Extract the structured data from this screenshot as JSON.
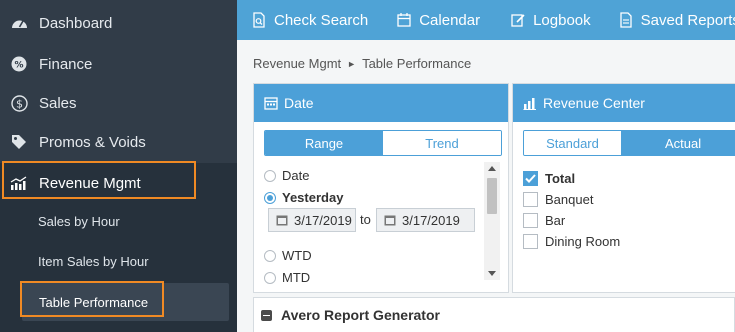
{
  "sidebar": {
    "items": [
      {
        "label": "Dashboard",
        "icon": "speedometer-icon"
      },
      {
        "label": "Finance",
        "icon": "percent-icon"
      },
      {
        "label": "Sales",
        "icon": "dollar-icon"
      },
      {
        "label": "Promos & Voids",
        "icon": "tag-icon"
      },
      {
        "label": "Revenue Mgmt",
        "icon": "bar-trend-icon"
      }
    ],
    "subitems": [
      {
        "label": "Sales by Hour"
      },
      {
        "label": "Item Sales by Hour"
      },
      {
        "label": "Table Performance"
      }
    ]
  },
  "topbar": {
    "items": [
      {
        "label": "Check Search",
        "icon": "document-search-icon"
      },
      {
        "label": "Calendar",
        "icon": "calendar-icon"
      },
      {
        "label": "Logbook",
        "icon": "edit-icon"
      },
      {
        "label": "Saved Reports",
        "icon": "file-icon"
      }
    ]
  },
  "breadcrumb": {
    "parent": "Revenue Mgmt",
    "separator": "►",
    "current": "Table Performance"
  },
  "date_panel": {
    "title": "Date",
    "toggle": {
      "options": [
        "Range",
        "Trend"
      ],
      "selected": "Range"
    },
    "options": [
      {
        "label": "Date",
        "selected": false
      },
      {
        "label": "Yesterday",
        "selected": true
      },
      {
        "label": "WTD",
        "selected": false
      },
      {
        "label": "MTD",
        "selected": false
      }
    ],
    "from_date": "3/17/2019",
    "to_label": "to",
    "to_date": "3/17/2019"
  },
  "revenue_panel": {
    "title": "Revenue Center",
    "toggle": {
      "options": [
        "Standard",
        "Actual"
      ],
      "selected": "Actual"
    },
    "items": [
      {
        "label": "Total",
        "checked": true
      },
      {
        "label": "Banquet",
        "checked": false
      },
      {
        "label": "Bar",
        "checked": false
      },
      {
        "label": "Dining Room",
        "checked": false
      }
    ]
  },
  "report_generator": {
    "title": "Avero Report Generator"
  },
  "colors": {
    "accent": "#4ca0d8",
    "sidebar": "#313c48",
    "highlight": "#f08a24"
  }
}
